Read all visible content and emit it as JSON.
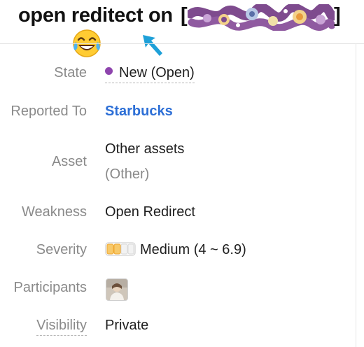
{
  "header": {
    "title": "open reditect on",
    "bracket_open": "[",
    "bracket_close": "]"
  },
  "fields": {
    "state": {
      "label": "State",
      "value": "New (Open)",
      "dot_color": "#8e44ad"
    },
    "reported_to": {
      "label": "Reported To",
      "value": "Starbucks"
    },
    "asset": {
      "label": "Asset",
      "value": "Other assets",
      "sub": "(Other)"
    },
    "weakness": {
      "label": "Weakness",
      "value": "Open Redirect"
    },
    "severity": {
      "label": "Severity",
      "value": "Medium (4 ~ 6.9)",
      "level_filled": 2,
      "level_total": 4,
      "color": "#f0a830"
    },
    "participants": {
      "label": "Participants"
    },
    "visibility": {
      "label": "Visibility",
      "value": "Private"
    }
  },
  "icons": {
    "emoji": "laughing-tears-emoji-icon",
    "arrow": "arrow-pointer-icon",
    "redaction": "redaction-scribble-icon"
  },
  "colors": {
    "link": "#2d6fd6",
    "label": "#8a8a8a",
    "redaction_purple": "#7e4b8e",
    "arrow": "#1ea0d8"
  }
}
